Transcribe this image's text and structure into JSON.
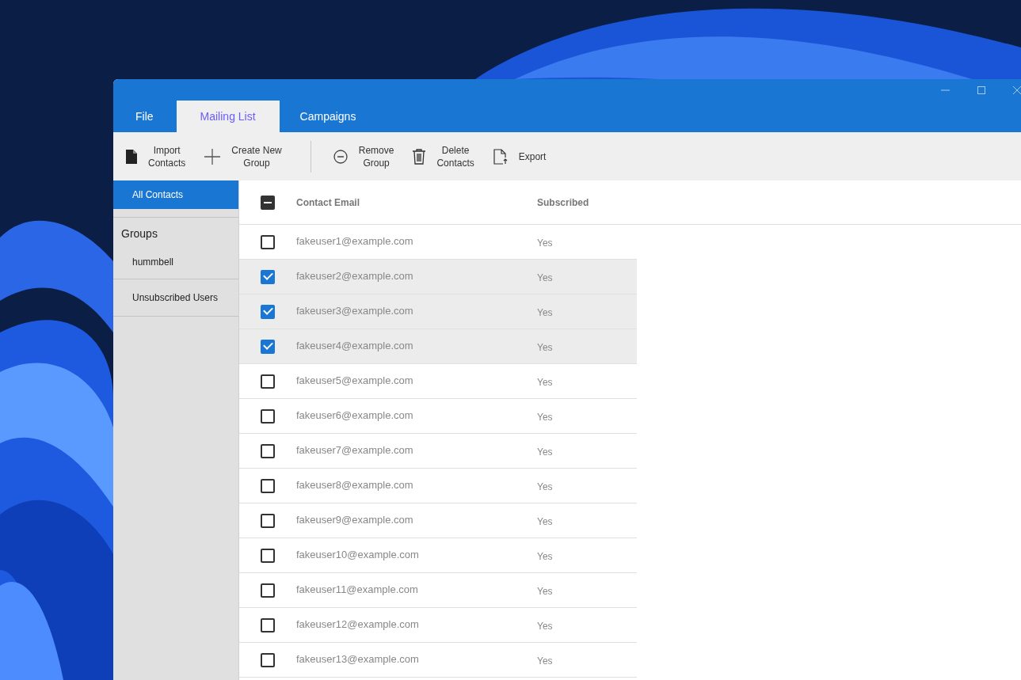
{
  "window": {
    "tabs": [
      {
        "label": "File",
        "selected": false
      },
      {
        "label": "Mailing List",
        "selected": true
      },
      {
        "label": "Campaigns",
        "selected": false
      }
    ]
  },
  "toolbar": {
    "groups": [
      [
        {
          "label": "Import\nContacts",
          "kind": "file"
        },
        {
          "label": "Create New\nGroup",
          "kind": "plus"
        }
      ],
      [
        {
          "label": "Remove\nGroup",
          "kind": "minus"
        },
        {
          "label": "Delete\nContacts",
          "kind": "trash"
        },
        {
          "label": "Export",
          "kind": "export"
        }
      ]
    ]
  },
  "sidebar": {
    "items": [
      {
        "kind": "item",
        "label": "All Contacts",
        "selected": true
      },
      {
        "kind": "heading",
        "label": "Groups"
      },
      {
        "kind": "item",
        "label": "hummbell",
        "selected": false
      },
      {
        "kind": "item",
        "label": "Unsubscribed Users",
        "selected": false
      }
    ]
  },
  "table": {
    "select_all": {
      "indeterminate": true
    },
    "columns": [
      "Contact Email",
      "Subscribed"
    ],
    "rows": [
      {
        "email": "fakeuser1@example.com",
        "subscribed": "Yes",
        "checked": false
      },
      {
        "email": "fakeuser2@example.com",
        "subscribed": "Yes",
        "checked": true
      },
      {
        "email": "fakeuser3@example.com",
        "subscribed": "Yes",
        "checked": true
      },
      {
        "email": "fakeuser4@example.com",
        "subscribed": "Yes",
        "checked": true
      },
      {
        "email": "fakeuser5@example.com",
        "subscribed": "Yes",
        "checked": false
      },
      {
        "email": "fakeuser6@example.com",
        "subscribed": "Yes",
        "checked": false
      },
      {
        "email": "fakeuser7@example.com",
        "subscribed": "Yes",
        "checked": false
      },
      {
        "email": "fakeuser8@example.com",
        "subscribed": "Yes",
        "checked": false
      },
      {
        "email": "fakeuser9@example.com",
        "subscribed": "Yes",
        "checked": false
      },
      {
        "email": "fakeuser10@example.com",
        "subscribed": "Yes",
        "checked": false
      },
      {
        "email": "fakeuser11@example.com",
        "subscribed": "Yes",
        "checked": false
      },
      {
        "email": "fakeuser12@example.com",
        "subscribed": "Yes",
        "checked": false
      },
      {
        "email": "fakeuser13@example.com",
        "subscribed": "Yes",
        "checked": false
      }
    ]
  }
}
